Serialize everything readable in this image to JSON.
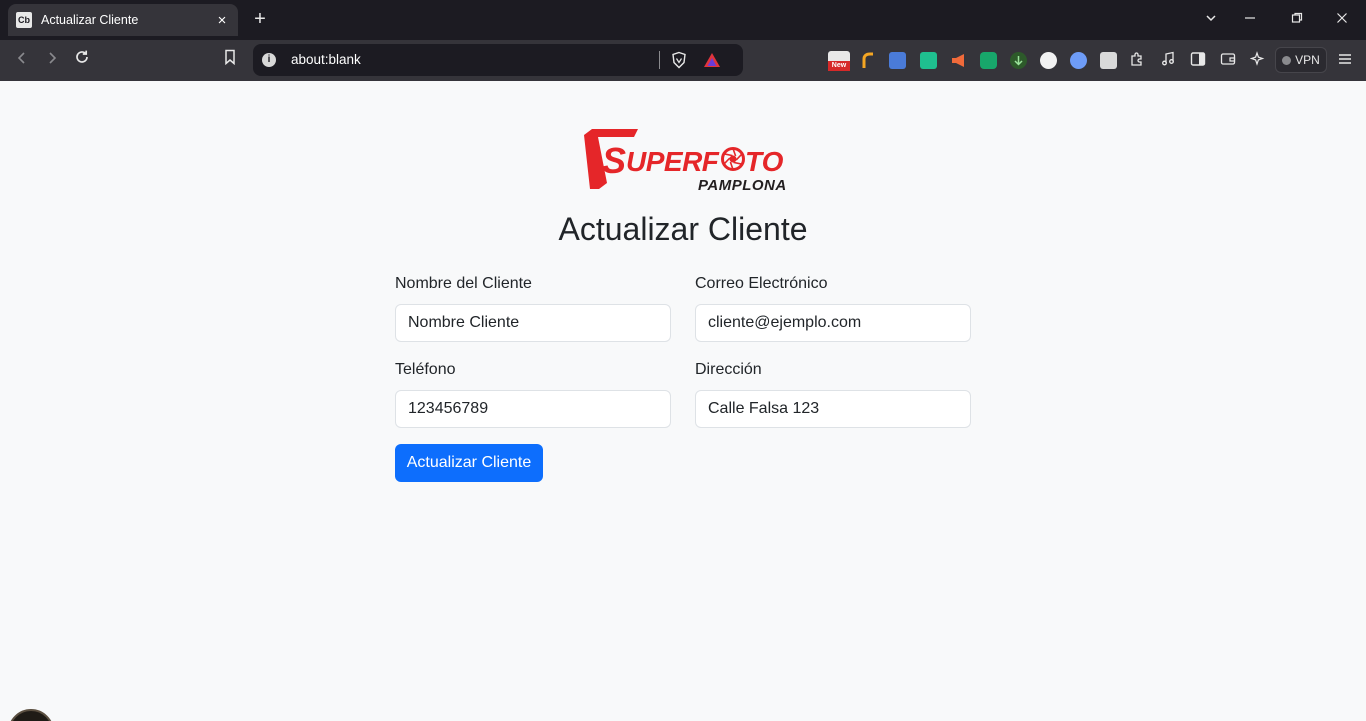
{
  "browser": {
    "tab": {
      "favicon_text": "Cb",
      "title": "Actualizar Cliente",
      "close_label": "×"
    },
    "new_tab_label": "+",
    "address": "about:blank",
    "vpn_label": "VPN"
  },
  "colors": {
    "primary": "#0d6efd",
    "logo_red": "#e52629",
    "logo_dark": "#231f20",
    "page_bg": "#f8f9fa"
  },
  "logo": {
    "brand_top": "SUPERF TO",
    "brand_sub": "PAMPLONA"
  },
  "page": {
    "title": "Actualizar Cliente"
  },
  "form": {
    "name": {
      "label": "Nombre del Cliente",
      "value": "Nombre Cliente"
    },
    "email": {
      "label": "Correo Electrónico",
      "value": "cliente@ejemplo.com"
    },
    "phone": {
      "label": "Teléfono",
      "value": "123456789"
    },
    "address": {
      "label": "Dirección",
      "value": "Calle Falsa 123"
    },
    "submit_label": "Actualizar Cliente"
  }
}
